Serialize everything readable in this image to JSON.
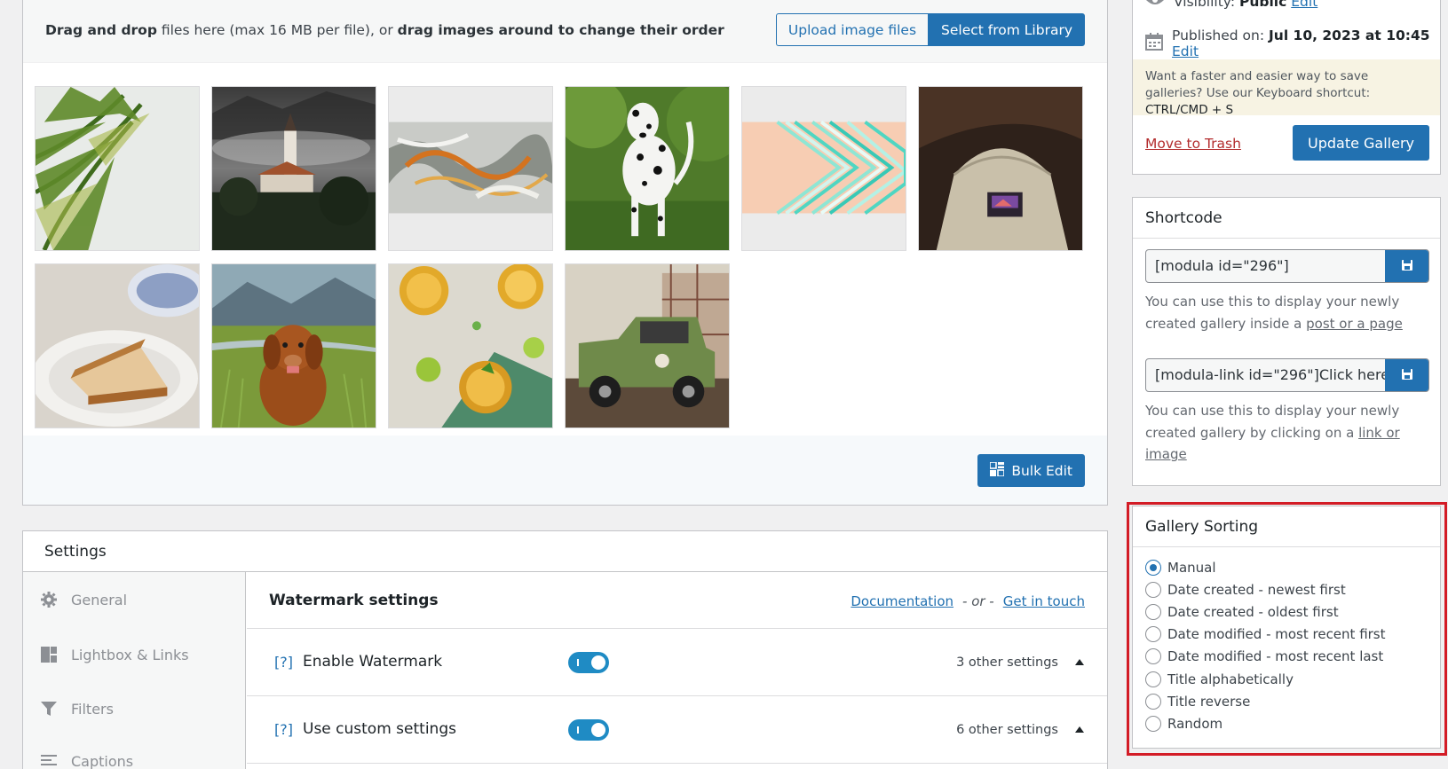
{
  "upload": {
    "drag_bold_1": "Drag and drop",
    "drag_text_1": " files here (max 16 MB per file), or ",
    "drag_bold_2": "drag images around to change their order",
    "upload_button": "Upload image files",
    "library_button": "Select from Library",
    "bulk_edit_button": "Bulk Edit"
  },
  "gallery_images": [
    {
      "name": "palm-leaves-image"
    },
    {
      "name": "church-on-island-image"
    },
    {
      "name": "marble-texture-image"
    },
    {
      "name": "dalmatian-dog-image"
    },
    {
      "name": "abstract-stripes-image"
    },
    {
      "name": "cap-on-bag-image"
    },
    {
      "name": "cheesecake-image"
    },
    {
      "name": "golden-retriever-image"
    },
    {
      "name": "iced-tea-drinks-image"
    },
    {
      "name": "green-jeep-image"
    }
  ],
  "settings": {
    "title": "Settings",
    "nav": [
      {
        "label": "General",
        "icon": "gear-icon"
      },
      {
        "label": "Lightbox & Links",
        "icon": "layout-icon"
      },
      {
        "label": "Filters",
        "icon": "filter-icon"
      },
      {
        "label": "Captions",
        "icon": "captions-icon"
      }
    ],
    "watermark_title": "Watermark settings",
    "documentation_link": "Documentation",
    "or_text": "- or -",
    "get_in_touch_link": "Get in touch",
    "options": [
      {
        "help": "[?]",
        "label": "Enable Watermark",
        "other": "3 other settings",
        "enabled": true
      },
      {
        "help": "[?]",
        "label": "Use custom settings",
        "other": "6 other settings",
        "enabled": true
      }
    ]
  },
  "publish": {
    "visibility_label": "Visibility:",
    "visibility_value": "Public",
    "visibility_edit": "Edit",
    "published_label": "Published on:",
    "published_value": "Jul 10, 2023 at 10:45",
    "published_edit": "Edit",
    "notice_text": "Want a faster and easier way to save galleries? Use our Keyboard shortcut:",
    "notice_shortcut": "CTRL/CMD + S",
    "trash_link": "Move to Trash",
    "update_button": "Update Gallery"
  },
  "shortcode": {
    "title": "Shortcode",
    "code_1": "[modula id=\"296\"]",
    "desc_1_text": "You can use this to display your newly created gallery inside a ",
    "desc_1_link": "post or a page",
    "code_2": "[modula-link id=\"296\"]Click here",
    "desc_2_text": "You can use this to display your newly created gallery by clicking on a ",
    "desc_2_link": "link or image"
  },
  "sorting": {
    "title": "Gallery Sorting",
    "selected": "Manual",
    "options": [
      "Manual",
      "Date created - newest first",
      "Date created - oldest first",
      "Date modified - most recent first",
      "Date modified - most recent last",
      "Title alphabetically",
      "Title reverse",
      "Random"
    ]
  },
  "colors": {
    "accent": "#2271b1",
    "toggle": "#1f8bc4",
    "highlight": "#d31c26",
    "danger": "#b32d2e"
  }
}
